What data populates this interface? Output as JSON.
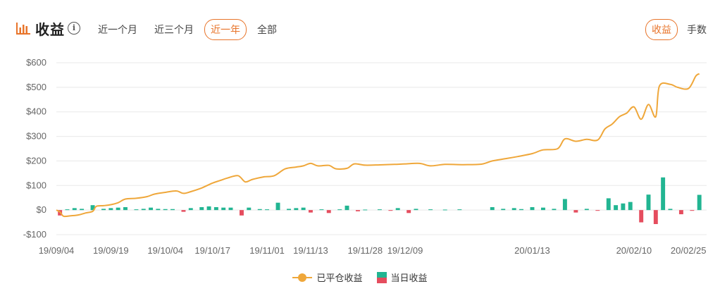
{
  "header": {
    "title": "收益",
    "title_icon": "bar-chart-icon",
    "info_icon_glyph": "i",
    "periods": [
      {
        "label": "近一个月",
        "active": false
      },
      {
        "label": "近三个月",
        "active": false
      },
      {
        "label": "近一年",
        "active": true
      },
      {
        "label": "全部",
        "active": false
      }
    ],
    "modes": [
      {
        "label": "收益",
        "active": true
      },
      {
        "label": "手数",
        "active": false
      }
    ]
  },
  "colors": {
    "accent": "#e8742a",
    "line": "#efa73a",
    "positive_bar": "#22b592",
    "negative_bar": "#e54d5e",
    "grid": "#e8e8e8"
  },
  "chart_data": {
    "type": "line+bar",
    "ylim": [
      -100,
      600
    ],
    "y_ticks": [
      -100,
      0,
      100,
      200,
      300,
      400,
      500,
      600
    ],
    "y_tick_labels": [
      "-$100",
      "$0",
      "$100",
      "$200",
      "$300",
      "$400",
      "$500",
      "$600"
    ],
    "x_range": [
      "2019-09-04",
      "2020-03-01"
    ],
    "x_ticks": [
      "2019-09-04",
      "2019-09-19",
      "2019-10-04",
      "2019-10-17",
      "2019-11-01",
      "2019-11-13",
      "2019-11-28",
      "2019-12-09",
      "2020-01-13",
      "2020-02-10",
      "2020-02-25"
    ],
    "x_tick_labels": [
      "19/09/04",
      "19/09/19",
      "19/10/04",
      "19/10/17",
      "19/11/01",
      "19/11/13",
      "19/11/28",
      "19/12/09",
      "20/01/13",
      "20/02/10",
      "20/02/25"
    ],
    "legend": [
      "已平仓收益",
      "当日收益"
    ],
    "grid": true,
    "series": [
      {
        "name": "已平仓收益",
        "type": "line",
        "points": [
          [
            "2019-09-04",
            0
          ],
          [
            "2019-09-05",
            -8
          ],
          [
            "2019-09-06",
            -25
          ],
          [
            "2019-09-08",
            -23
          ],
          [
            "2019-09-10",
            -20
          ],
          [
            "2019-09-12",
            -12
          ],
          [
            "2019-09-14",
            -5
          ],
          [
            "2019-09-15",
            15
          ],
          [
            "2019-09-17",
            18
          ],
          [
            "2019-09-19",
            22
          ],
          [
            "2019-09-21",
            30
          ],
          [
            "2019-09-23",
            45
          ],
          [
            "2019-09-26",
            48
          ],
          [
            "2019-09-29",
            55
          ],
          [
            "2019-10-01",
            65
          ],
          [
            "2019-10-04",
            72
          ],
          [
            "2019-10-07",
            78
          ],
          [
            "2019-10-09",
            68
          ],
          [
            "2019-10-11",
            75
          ],
          [
            "2019-10-14",
            90
          ],
          [
            "2019-10-17",
            110
          ],
          [
            "2019-10-19",
            120
          ],
          [
            "2019-10-21",
            130
          ],
          [
            "2019-10-24",
            140
          ],
          [
            "2019-10-26",
            115
          ],
          [
            "2019-10-28",
            125
          ],
          [
            "2019-10-31",
            135
          ],
          [
            "2019-11-03",
            140
          ],
          [
            "2019-11-06",
            168
          ],
          [
            "2019-11-09",
            175
          ],
          [
            "2019-11-11",
            180
          ],
          [
            "2019-11-13",
            190
          ],
          [
            "2019-11-15",
            180
          ],
          [
            "2019-11-18",
            182
          ],
          [
            "2019-11-20",
            168
          ],
          [
            "2019-11-23",
            170
          ],
          [
            "2019-11-25",
            188
          ],
          [
            "2019-11-28",
            183
          ],
          [
            "2019-12-02",
            184
          ],
          [
            "2019-12-06",
            186
          ],
          [
            "2019-12-09",
            188
          ],
          [
            "2019-12-13",
            190
          ],
          [
            "2019-12-16",
            180
          ],
          [
            "2019-12-20",
            186
          ],
          [
            "2019-12-25",
            185
          ],
          [
            "2019-12-30",
            187
          ],
          [
            "2020-01-02",
            200
          ],
          [
            "2020-01-06",
            210
          ],
          [
            "2020-01-09",
            218
          ],
          [
            "2020-01-13",
            230
          ],
          [
            "2020-01-16",
            245
          ],
          [
            "2020-01-20",
            250
          ],
          [
            "2020-01-22",
            290
          ],
          [
            "2020-01-25",
            280
          ],
          [
            "2020-01-28",
            288
          ],
          [
            "2020-01-31",
            285
          ],
          [
            "2020-02-02",
            330
          ],
          [
            "2020-02-04",
            350
          ],
          [
            "2020-02-06",
            380
          ],
          [
            "2020-02-08",
            395
          ],
          [
            "2020-02-10",
            420
          ],
          [
            "2020-02-12",
            370
          ],
          [
            "2020-02-14",
            430
          ],
          [
            "2020-02-16",
            380
          ],
          [
            "2020-02-17",
            505
          ],
          [
            "2020-02-20",
            512
          ],
          [
            "2020-02-22",
            500
          ],
          [
            "2020-02-25",
            495
          ],
          [
            "2020-02-27",
            545
          ],
          [
            "2020-02-28",
            555
          ]
        ]
      },
      {
        "name": "当日收益",
        "type": "bar",
        "points": [
          [
            "2019-09-05",
            -22
          ],
          [
            "2019-09-07",
            3
          ],
          [
            "2019-09-09",
            8
          ],
          [
            "2019-09-11",
            5
          ],
          [
            "2019-09-14",
            20
          ],
          [
            "2019-09-17",
            5
          ],
          [
            "2019-09-19",
            8
          ],
          [
            "2019-09-21",
            10
          ],
          [
            "2019-09-23",
            12
          ],
          [
            "2019-09-26",
            3
          ],
          [
            "2019-09-28",
            5
          ],
          [
            "2019-09-30",
            10
          ],
          [
            "2019-10-02",
            5
          ],
          [
            "2019-10-04",
            4
          ],
          [
            "2019-10-06",
            4
          ],
          [
            "2019-10-09",
            -7
          ],
          [
            "2019-10-11",
            8
          ],
          [
            "2019-10-14",
            12
          ],
          [
            "2019-10-16",
            15
          ],
          [
            "2019-10-18",
            12
          ],
          [
            "2019-10-20",
            10
          ],
          [
            "2019-10-22",
            10
          ],
          [
            "2019-10-25",
            -22
          ],
          [
            "2019-10-27",
            10
          ],
          [
            "2019-10-30",
            4
          ],
          [
            "2019-11-01",
            3
          ],
          [
            "2019-11-04",
            30
          ],
          [
            "2019-11-07",
            5
          ],
          [
            "2019-11-09",
            8
          ],
          [
            "2019-11-11",
            10
          ],
          [
            "2019-11-13",
            -10
          ],
          [
            "2019-11-16",
            3
          ],
          [
            "2019-11-18",
            -12
          ],
          [
            "2019-11-21",
            3
          ],
          [
            "2019-11-23",
            18
          ],
          [
            "2019-11-26",
            -5
          ],
          [
            "2019-11-28",
            2
          ],
          [
            "2019-12-02",
            3
          ],
          [
            "2019-12-05",
            -3
          ],
          [
            "2019-12-07",
            8
          ],
          [
            "2019-12-10",
            -12
          ],
          [
            "2019-12-12",
            5
          ],
          [
            "2019-12-16",
            3
          ],
          [
            "2019-12-20",
            2
          ],
          [
            "2019-12-24",
            3
          ],
          [
            "2020-01-02",
            12
          ],
          [
            "2020-01-05",
            5
          ],
          [
            "2020-01-08",
            8
          ],
          [
            "2020-01-10",
            4
          ],
          [
            "2020-01-13",
            12
          ],
          [
            "2020-01-16",
            10
          ],
          [
            "2020-01-19",
            5
          ],
          [
            "2020-01-22",
            45
          ],
          [
            "2020-01-25",
            -10
          ],
          [
            "2020-01-28",
            5
          ],
          [
            "2020-01-31",
            -3
          ],
          [
            "2020-02-03",
            48
          ],
          [
            "2020-02-05",
            20
          ],
          [
            "2020-02-07",
            27
          ],
          [
            "2020-02-09",
            33
          ],
          [
            "2020-02-12",
            -50
          ],
          [
            "2020-02-14",
            63
          ],
          [
            "2020-02-16",
            -57
          ],
          [
            "2020-02-18",
            133
          ],
          [
            "2020-02-20",
            5
          ],
          [
            "2020-02-23",
            -17
          ],
          [
            "2020-02-26",
            -3
          ],
          [
            "2020-02-28",
            62
          ]
        ]
      }
    ]
  }
}
